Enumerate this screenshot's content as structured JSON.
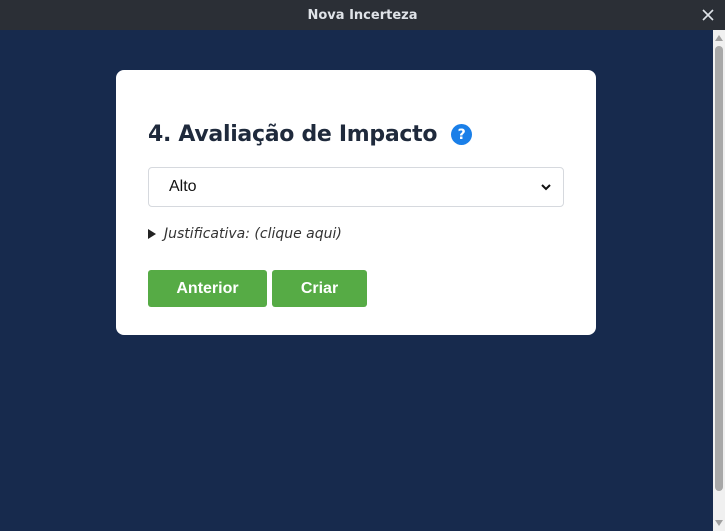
{
  "window": {
    "title": "Nova Incerteza",
    "close_icon": "close-icon"
  },
  "form": {
    "heading": "4. Avaliação de Impacto",
    "help_icon_glyph": "?",
    "impact_select": {
      "selected_value": "Alto"
    },
    "justification_toggle": "Justificativa: (clique aqui)",
    "buttons": {
      "previous": "Anterior",
      "create": "Criar"
    }
  },
  "colors": {
    "background": "#172a4d",
    "titlebar": "#2b2f36",
    "card": "#ffffff",
    "button": "#56ab45",
    "help_icon": "#1a7fe8"
  }
}
